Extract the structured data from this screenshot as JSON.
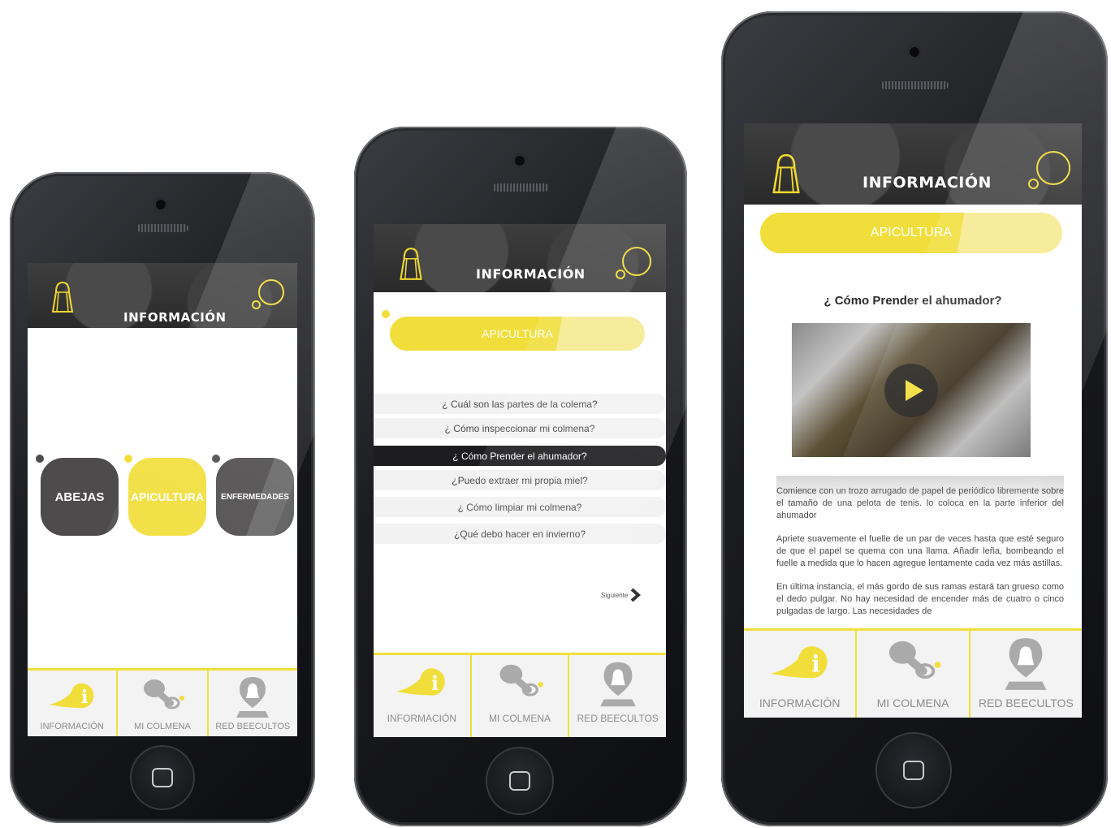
{
  "colors": {
    "accent": "#f1de3b",
    "dark": "#4d4b4b",
    "header": "#333333"
  },
  "phone1": {
    "header_title": "INFORMACIÓN",
    "categories": [
      {
        "label": "ABEJAS"
      },
      {
        "label": "APICULTURA"
      },
      {
        "label": "ENFERMEDADES"
      }
    ],
    "tabs": [
      {
        "label": "INFORMACIÓN",
        "icon": "info-bulb-icon"
      },
      {
        "label": "MI COLMENA",
        "icon": "bee-icon"
      },
      {
        "label": "RED BEECULTOS",
        "icon": "beekeeper-pin-icon"
      }
    ]
  },
  "phone2": {
    "header_title": "INFORMACIÓN",
    "section_pill": "APICULTURA",
    "questions": [
      "¿ Cuál son las partes de la colema?",
      "¿ Cómo inspeccionar mi colmena?",
      "¿ Cómo Prender el ahumador?",
      "¿Puedo extraer mi propia miel?",
      "¿ Cómo limpiar mi colmena?",
      "¿Qué debo hacer en invierno?"
    ],
    "next_label": "Siguiente",
    "tabs": [
      {
        "label": "INFORMACIÓN"
      },
      {
        "label": "MI COLMENA"
      },
      {
        "label": "RED BEECULTOS"
      }
    ]
  },
  "phone3": {
    "header_title": "INFORMACIÓN",
    "section_pill": "APICULTURA",
    "article_title": "¿ Cómo Prender el ahumador?",
    "paragraphs": [
      "Comience con un trozo arrugado de papel de periódico libremente sobre el tamaño de una pelota de tenis. lo coloca en la parte inferior del ahumador",
      "Apriete suavemente el fuelle de un par de veces hasta que esté seguro de que el papel se quema con una llama. Añadir leña, bombeando el fuelle a medida que lo hacen agregue lentamente cada vez más astillas.",
      "En última instancia, el más gordo de sus ramas estará tan grueso como el dedo pulgar. No hay necesidad de encender más de cuatro o cinco pulgadas de largo. Las necesidades de"
    ],
    "tabs": [
      {
        "label": "INFORMACIÓN"
      },
      {
        "label": "MI COLMENA"
      },
      {
        "label": "RED BEECULTOS"
      }
    ]
  }
}
